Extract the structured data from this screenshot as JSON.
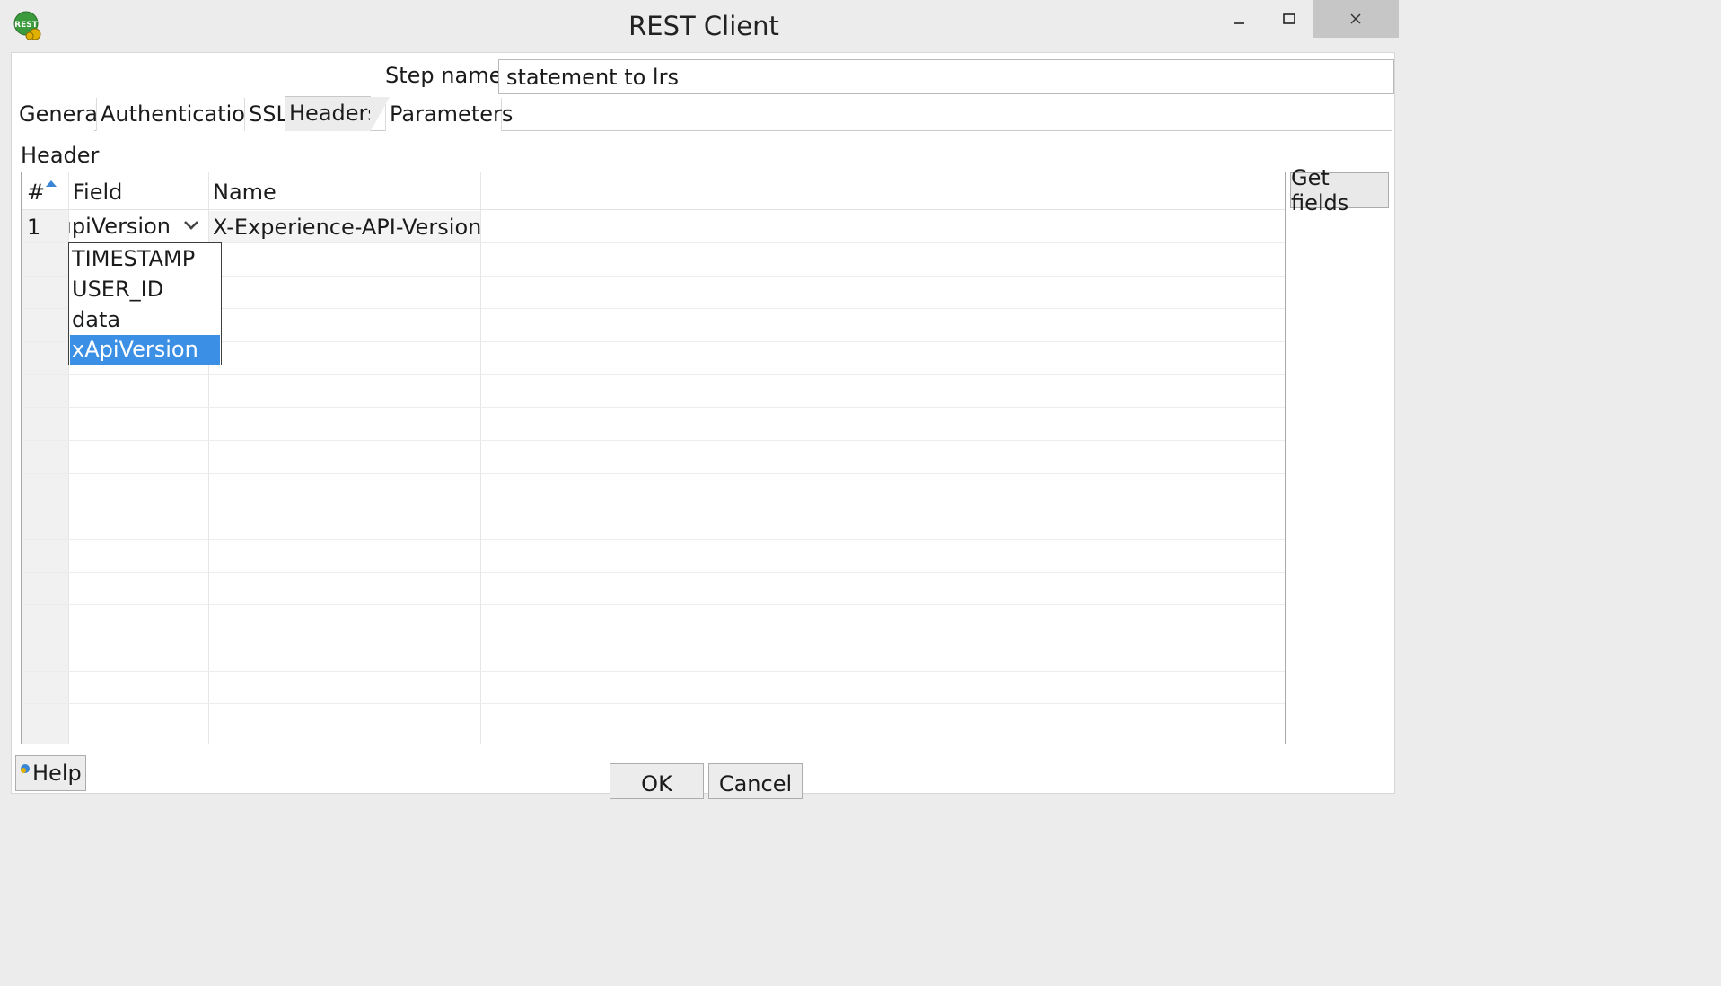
{
  "window": {
    "title": "REST Client",
    "icon": "rest-client-icon",
    "controls": {
      "minimize_icon": "minimize-icon",
      "maximize_icon": "maximize-icon",
      "close_icon": "close-icon"
    }
  },
  "step": {
    "label": "Step name",
    "value": "statement to lrs"
  },
  "tabs": [
    {
      "label": "General",
      "active": false
    },
    {
      "label": "Authentication",
      "active": false
    },
    {
      "label": "SSL",
      "active": false
    },
    {
      "label": "Headers",
      "active": true
    },
    {
      "label": "Parameters",
      "active": false
    }
  ],
  "headers": {
    "section_label": "Header",
    "columns": {
      "num": "#",
      "field": "Field",
      "name": "Name"
    },
    "rows": [
      {
        "num": "1",
        "field": "xApiVersion",
        "field_visible": "ıpiVersion",
        "name": "X-Experience-API-Version"
      }
    ],
    "field_dropdown": {
      "options": [
        "TIMESTAMP",
        "USER_ID",
        "data",
        "xApiVersion"
      ],
      "selected": "xApiVersion"
    },
    "get_fields_label": "Get fields"
  },
  "buttons": {
    "help": "Help",
    "ok": "OK",
    "cancel": "Cancel"
  },
  "colors": {
    "selection": "#3b8fe5",
    "sort_arrow": "#3a86d6",
    "window_bg": "#ececec"
  }
}
